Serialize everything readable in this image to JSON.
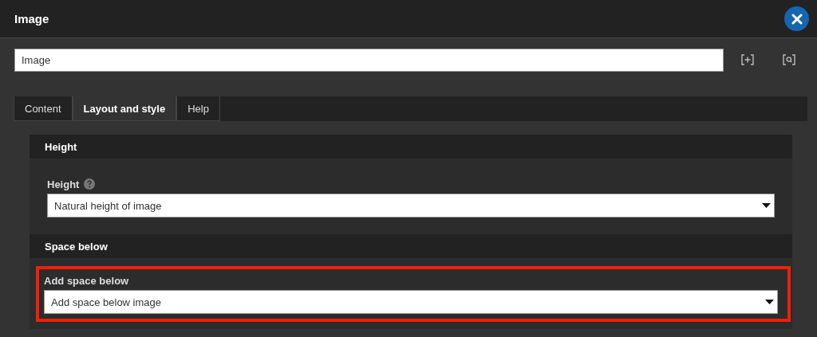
{
  "window": {
    "title": "Image"
  },
  "title_field": {
    "value": "Image"
  },
  "tabs": [
    {
      "label": "Content",
      "selected": false
    },
    {
      "label": "Layout and style",
      "selected": true
    },
    {
      "label": "Help",
      "selected": false
    }
  ],
  "sections": [
    {
      "heading": "Height",
      "field": {
        "label": "Height",
        "help": true,
        "value": "Natural height of image",
        "highlighted": false
      }
    },
    {
      "heading": "Space below",
      "field": {
        "label": "Add space below",
        "help": false,
        "value": "Add space below image",
        "highlighted": true
      }
    }
  ]
}
